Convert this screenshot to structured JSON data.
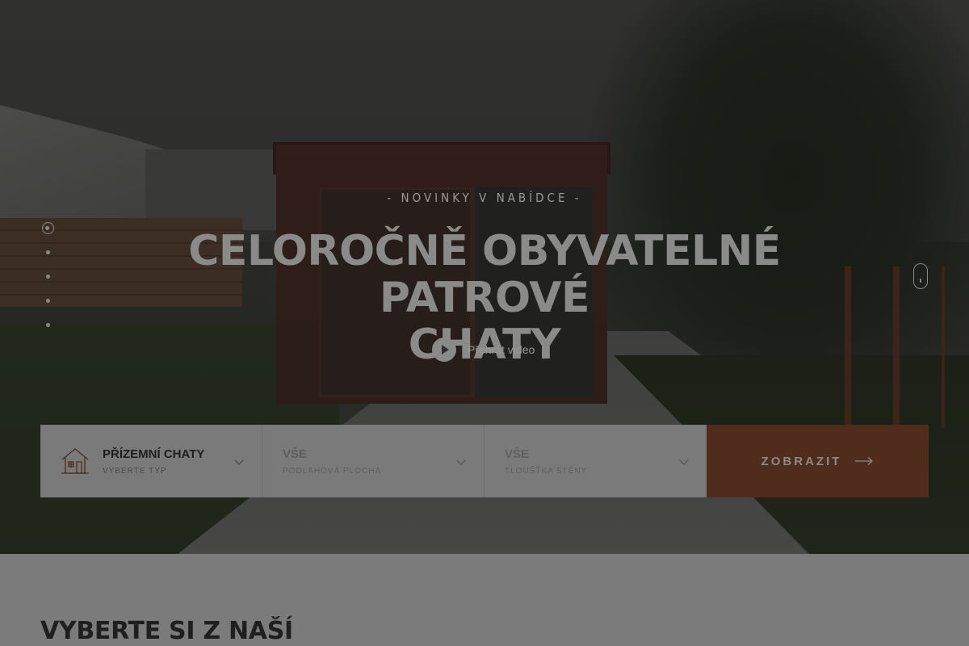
{
  "hero": {
    "kicker": "-  NOVINKY V NABÍDCE  -",
    "headline_line1": "CELOROČNĚ OBYVATELNÉ PATROVÉ",
    "headline_line2": "CHATY",
    "play_label": "Přehrát video",
    "slide_count": 5,
    "active_slide": 1
  },
  "filter": {
    "type": {
      "title": "PŘÍZEMNÍ CHATY",
      "subtitle": "VYBERTE TYP"
    },
    "area": {
      "title": "VŠE",
      "subtitle": "PODLAHOVÁ PLOCHA"
    },
    "wall": {
      "title": "VŠE",
      "subtitle": "TLOUŠŤKA STĚNY"
    },
    "submit_label": "ZOBRAZIT"
  },
  "section": {
    "title": "VYBERTE SI Z NAŠÍ"
  },
  "colors": {
    "accent": "#4f2c1c",
    "filter_bg": "#7a7a7a",
    "page_bg": "#7b7b7b"
  },
  "icons": [
    "house-icon",
    "chevron-down-icon",
    "arrow-right-icon",
    "play-icon",
    "mouse-scroll-icon"
  ]
}
